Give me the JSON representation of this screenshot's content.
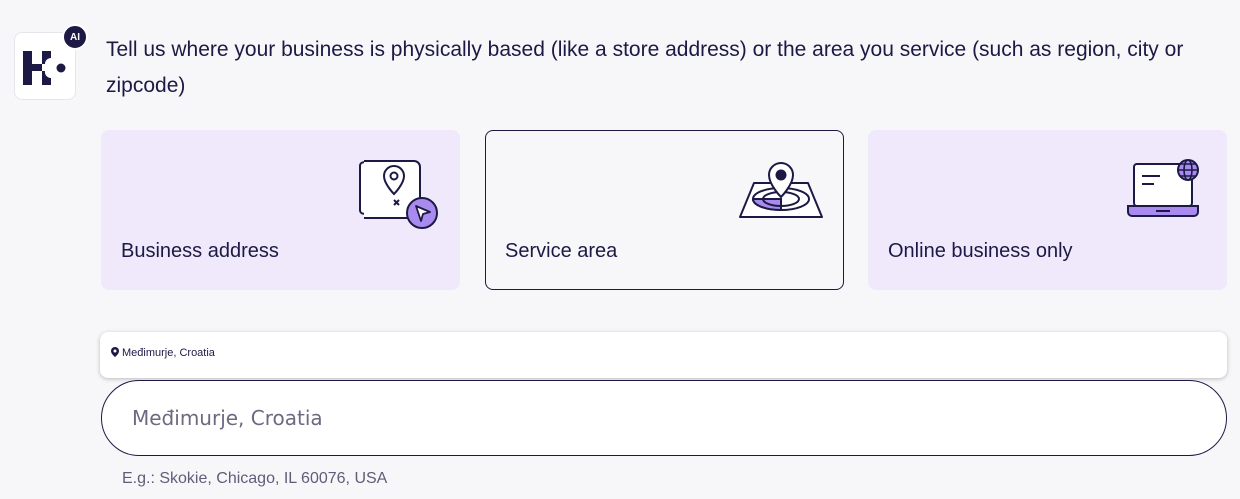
{
  "assistant": {
    "badge": "AI"
  },
  "prompt": "Tell us where your business is physically based (like a store address) or the area you service (such as region, city or zipcode)",
  "options": [
    {
      "label": "Business address",
      "icon": "map-pin-cursor-icon",
      "selected": false
    },
    {
      "label": "Service area",
      "icon": "location-target-icon",
      "selected": true
    },
    {
      "label": "Online business only",
      "icon": "laptop-globe-icon",
      "selected": false
    }
  ],
  "suggestion": {
    "text": "Međimurje, Croatia",
    "icon": "map-pin-icon"
  },
  "location_input": {
    "value": "Međimurje, Croatia",
    "placeholder": "Međimurje, Croatia"
  },
  "hint": "E.g.: Skokie, Chicago, IL 60076, USA",
  "colors": {
    "navy": "#1c1a44",
    "lavender": "#efe9fb",
    "purple": "#a98bf0",
    "background": "#f7f7f9"
  }
}
